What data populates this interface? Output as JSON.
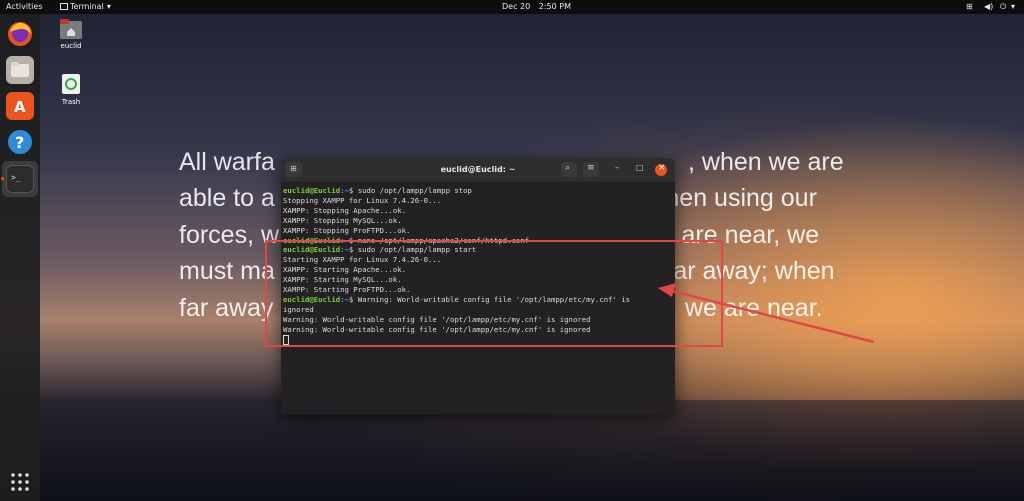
{
  "topbar": {
    "activities": "Activities",
    "app_menu": "Terminal",
    "date": "Dec 20",
    "time": "2:50 PM"
  },
  "desktop": {
    "icons": [
      {
        "label": "euclid"
      },
      {
        "label": "Trash"
      }
    ],
    "overlay_lines": [
      "All warfa",
      ", when we are",
      "able to a",
      "ust seem unable; when using our",
      "forces, w",
      "; when we are near, we",
      "must ma",
      "my believe we are far away; when",
      "far away",
      "we are near."
    ]
  },
  "terminal": {
    "title": "euclid@Euclid: ~",
    "lines": [
      {
        "user": "euclid@Euclid",
        "path": ":~",
        "rest": "$ sudo /opt/lampp/lampp stop"
      },
      {
        "text": "Stopping XAMPP for Linux 7.4.26-0..."
      },
      {
        "text": "XAMPP: Stopping Apache...ok."
      },
      {
        "text": "XAMPP: Stopping MySQL...ok."
      },
      {
        "text": "XAMPP: Stopping ProFTPD...ok."
      },
      {
        "user": "euclid@Euclid",
        "path": ":~",
        "rest": "$ nano /opt/lampp/apache2/conf/httpd.conf"
      },
      {
        "user": "euclid@Euclid",
        "path": ":~",
        "rest": "$ sudo /opt/lampp/lampp start"
      },
      {
        "text": "Starting XAMPP for Linux 7.4.26-0..."
      },
      {
        "text": "XAMPP: Starting Apache...ok."
      },
      {
        "text": "XAMPP: Starting MySQL...ok."
      },
      {
        "text": "XAMPP: Starting ProFTPD...ok."
      },
      {
        "user": "euclid@Euclid",
        "path": ":~",
        "rest": "$ Warning: World-writable config file '/opt/lampp/etc/my.cnf' is"
      },
      {
        "text": "ignored"
      },
      {
        "text": "Warning: World-writable config file '/opt/lampp/etc/my.cnf' is ignored"
      },
      {
        "text": "Warning: World-writable config file '/opt/lampp/etc/my.cnf' is ignored"
      }
    ]
  },
  "colors": {
    "annotation": "#e04848",
    "prompt_user": "#7bd03a",
    "prompt_path": "#6aa0e0",
    "close_button": "#e95420"
  }
}
